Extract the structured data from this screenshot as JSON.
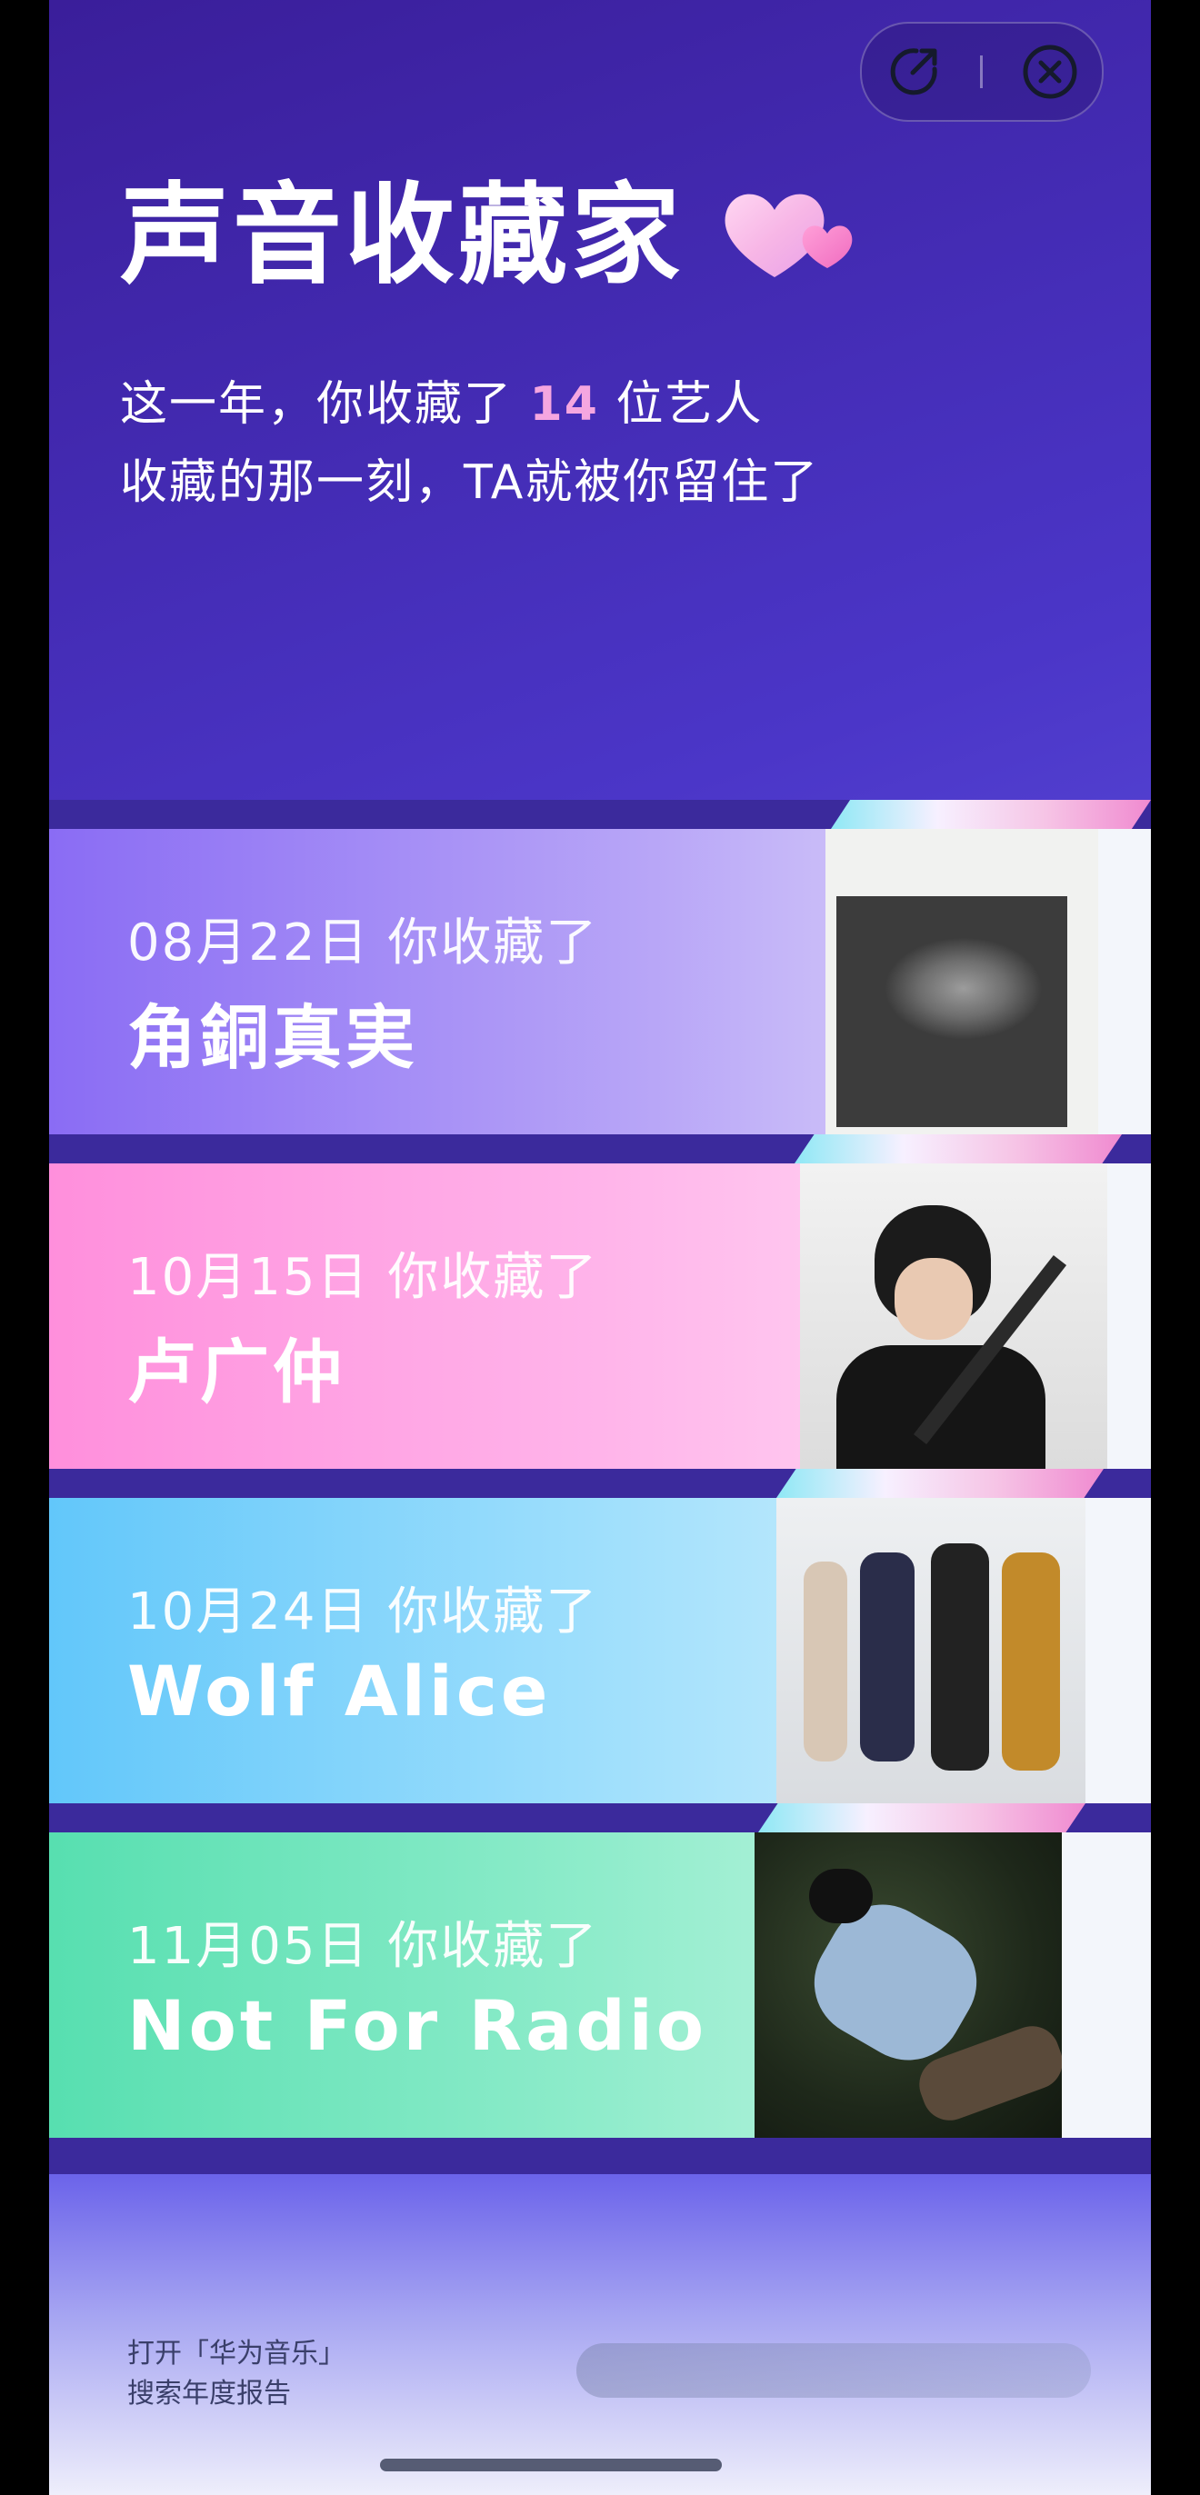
{
  "header": {
    "title": "声音收藏家",
    "sub1_prefix": "这一年，你收藏了",
    "sub1_count": "14",
    "sub1_suffix": "位艺人",
    "sub2": "收藏的那一刻，TA就被你留住了"
  },
  "actions": {
    "share_icon": "share-icon",
    "close_icon": "close-icon"
  },
  "items": [
    {
      "date": "08月22日 你收藏了",
      "artist": "角銅真実"
    },
    {
      "date": "10月15日 你收藏了",
      "artist": "卢广仲"
    },
    {
      "date": "10月24日 你收藏了",
      "artist": "Wolf Alice"
    },
    {
      "date": "11月05日 你收藏了",
      "artist": "Not For Radio"
    }
  ],
  "footer": {
    "line1": "打开「华为音乐」",
    "line2": "搜索年度报告"
  },
  "colors": {
    "background": "#4b36c8",
    "highlight": "#f5a6e0",
    "card1": "#8a6cf4",
    "card2": "#ff8fdc",
    "card3": "#62c7fa",
    "card4": "#57dfb0"
  }
}
